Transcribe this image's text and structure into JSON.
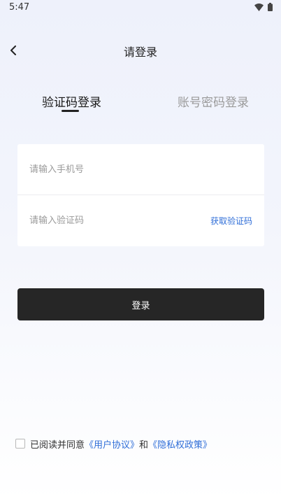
{
  "status_bar": {
    "time": "5:47",
    "wifi_icon": "wifi-icon",
    "battery_icon": "battery-icon"
  },
  "header": {
    "back_icon": "chevron-left-icon",
    "title": "请登录"
  },
  "tabs": [
    {
      "label": "验证码登录",
      "active": true
    },
    {
      "label": "账号密码登录",
      "active": false
    }
  ],
  "form": {
    "phone_placeholder": "请输入手机号",
    "phone_value": "",
    "code_placeholder": "请输入验证码",
    "code_value": "",
    "get_code_label": "获取验证码"
  },
  "login_button_label": "登录",
  "agreement": {
    "prefix": "已阅读并同意",
    "user_agreement": "《用户协议》",
    "conjunction": "和",
    "privacy_policy": "《隐私权政策》",
    "checked": false
  },
  "colors": {
    "accent_link": "#2f6ed8",
    "button_bg": "#262626",
    "background_top": "#eef1fb"
  }
}
